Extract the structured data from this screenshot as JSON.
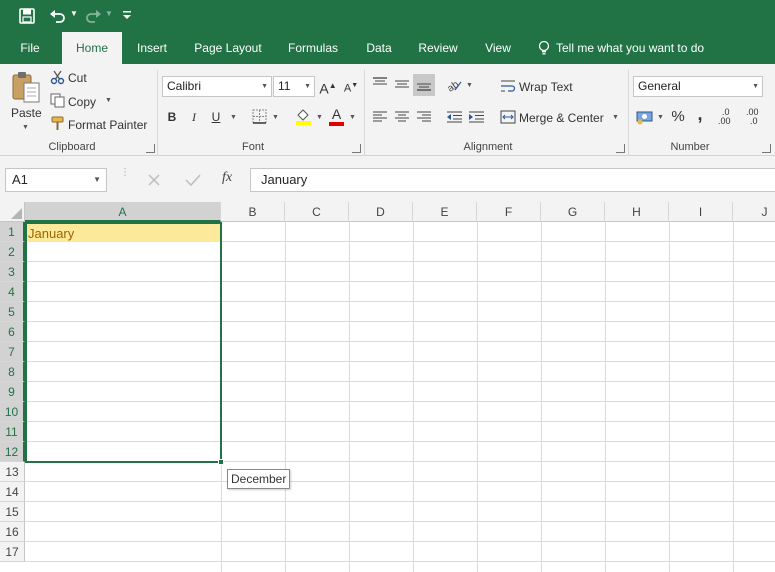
{
  "quick_access": {
    "save_icon": "save-icon",
    "undo_icon": "undo-icon",
    "redo_icon": "redo-icon",
    "customize_icon": "customize-toolbar-icon"
  },
  "tabs": [
    "File",
    "Home",
    "Insert",
    "Page Layout",
    "Formulas",
    "Data",
    "Review",
    "View"
  ],
  "active_tab": "Home",
  "tell_me": "Tell me what you want to do",
  "clipboard": {
    "paste": "Paste",
    "cut": "Cut",
    "copy": "Copy",
    "format_painter": "Format Painter",
    "group_label": "Clipboard"
  },
  "font": {
    "family": "Calibri",
    "size": "11",
    "bold": "B",
    "italic": "I",
    "underline": "U",
    "grow": "A",
    "shrink": "A",
    "color_letter": "A",
    "group_label": "Font"
  },
  "alignment": {
    "wrap_text": "Wrap Text",
    "merge_center": "Merge & Center",
    "group_label": "Alignment"
  },
  "number": {
    "format": "General",
    "percent": "%",
    "comma": ",",
    "inc_decimal": ".00",
    "dec_decimal": ".0",
    "group_label": "Number"
  },
  "formula_bar": {
    "name_box": "A1",
    "fx": "fx",
    "value": "January"
  },
  "columns": [
    "A",
    "B",
    "C",
    "D",
    "E",
    "F",
    "G",
    "H",
    "I",
    "J"
  ],
  "rows": [
    "1",
    "2",
    "3",
    "4",
    "5",
    "6",
    "7",
    "8",
    "9",
    "10",
    "11",
    "12",
    "13",
    "14",
    "15",
    "16",
    "17"
  ],
  "cells": {
    "A1": "January"
  },
  "autofill_tooltip": "December",
  "colors": {
    "accent": "#217346",
    "selected_cell_fill": "#fce99a",
    "selected_cell_text": "#9c6500"
  }
}
